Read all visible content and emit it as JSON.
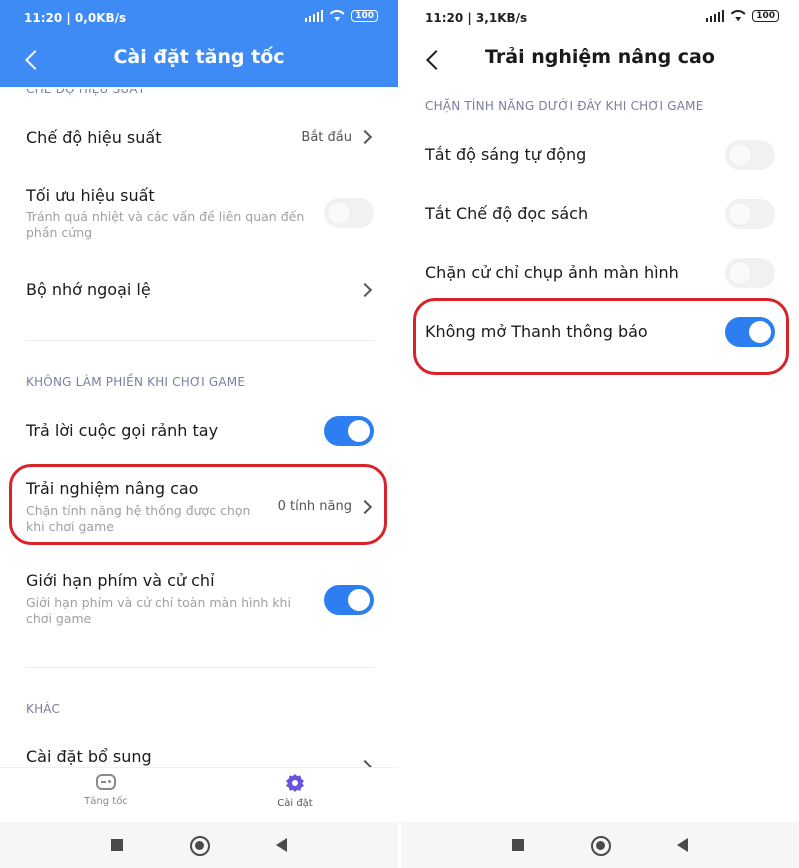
{
  "left": {
    "status": {
      "time": "11:20 | 0,0KB/s",
      "battery": "100"
    },
    "title": "Cài đặt tăng tốc",
    "section_performance": "CHẾ ĐỘ HIỆU SUẤT",
    "performance_mode": {
      "title": "Chế độ hiệu suất",
      "value": "Bắt đầu"
    },
    "optimize": {
      "title": "Tối ưu hiệu suất",
      "subtitle": "Tránh quá nhiệt và các vấn đề liên quan đến phần cứng",
      "enabled": false
    },
    "exception_memory": {
      "title": "Bộ nhớ ngoại lệ"
    },
    "section_dnd": "KHÔNG LÀM PHIỀN KHI CHƠI GAME",
    "handsfree": {
      "title": "Trả lời cuộc gọi rảnh tay",
      "enabled": true
    },
    "advanced": {
      "title": "Trải nghiệm nâng cao",
      "subtitle": "Chặn tính năng hệ thống được chọn khi chơi game",
      "value": "0 tính năng"
    },
    "limit_keys": {
      "title": "Giới hạn phím và cử chỉ",
      "subtitle": "Giới hạn phím và cử chỉ toàn màn hình khi chơi game",
      "enabled": true
    },
    "section_other": "KHÁC",
    "extra_settings": {
      "title": "Cài đặt bổ sung"
    },
    "tabs": [
      {
        "label": "Tăng tốc",
        "icon": "gamepad-icon"
      },
      {
        "label": "Cài đặt",
        "icon": "gear-icon"
      }
    ]
  },
  "right": {
    "status": {
      "time": "11:20 | 3,1KB/s",
      "battery": "100"
    },
    "title": "Trải nghiệm nâng cao",
    "section": "CHẶN TÍNH NĂNG DƯỚI ĐÂY KHI CHƠI GAME",
    "items": [
      {
        "title": "Tắt độ sáng tự động",
        "enabled": false
      },
      {
        "title": "Tắt Chế độ đọc sách",
        "enabled": false
      },
      {
        "title": "Chặn cử chỉ chụp ảnh màn hình",
        "enabled": false
      },
      {
        "title": "Không mở Thanh thông báo",
        "enabled": true
      }
    ]
  },
  "colors": {
    "header": "#3e8bf5",
    "toggle_on": "#2d7ff1",
    "highlight": "#d9232b",
    "section_label": "#7a7ea0"
  }
}
